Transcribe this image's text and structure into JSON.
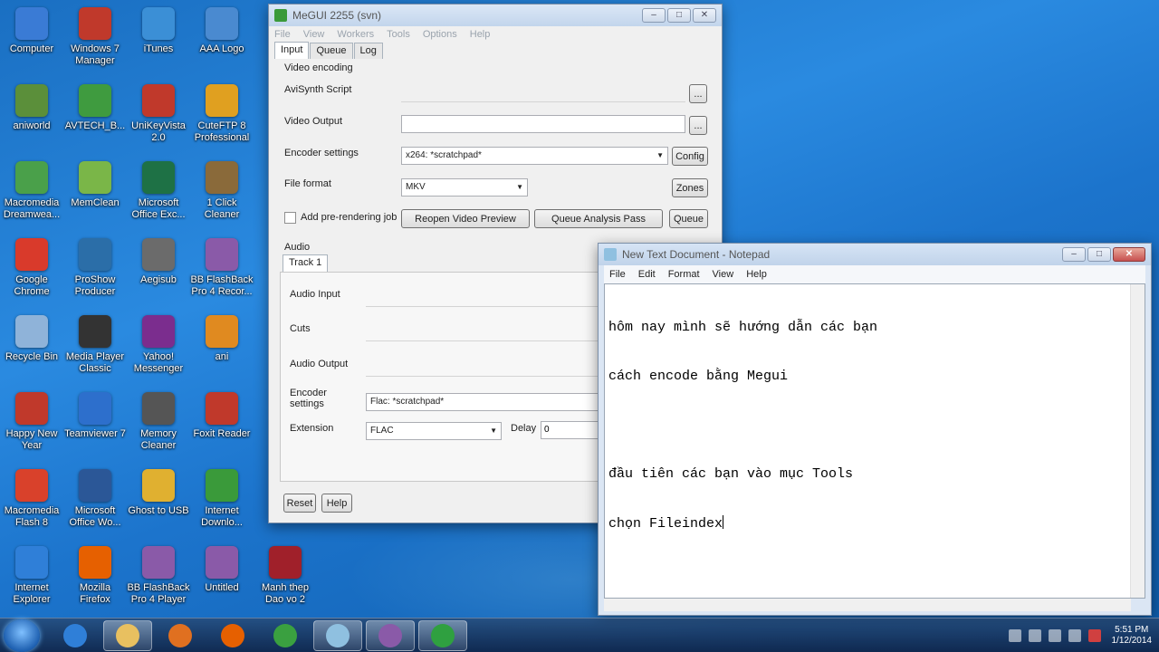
{
  "desktop": {
    "icons": [
      {
        "label": "Computer",
        "color": "#3a7bd5"
      },
      {
        "label": "aniworld",
        "color": "#5b8f3a"
      },
      {
        "label": "Macromedia Dreamwea...",
        "color": "#4aa04a"
      },
      {
        "label": "Google Chrome",
        "color": "#d93a2b"
      },
      {
        "label": "Recycle Bin",
        "color": "#8fb3d9"
      },
      {
        "label": "Happy New Year",
        "color": "#c0392b"
      },
      {
        "label": "Macromedia Flash 8",
        "color": "#d9412b"
      },
      {
        "label": "Internet Explorer",
        "color": "#2f7fd8"
      },
      {
        "label": "Windows 7 Manager",
        "color": "#c0392b"
      },
      {
        "label": "AVTECH_B...",
        "color": "#3f9b3f"
      },
      {
        "label": "MemClean",
        "color": "#7ab648"
      },
      {
        "label": "ProShow Producer",
        "color": "#2b6ea8"
      },
      {
        "label": "Media Player Classic",
        "color": "#333333"
      },
      {
        "label": "Teamviewer 7",
        "color": "#2d6fcc"
      },
      {
        "label": "Microsoft Office Wo...",
        "color": "#2b5797"
      },
      {
        "label": "Mozilla Firefox",
        "color": "#e66000"
      },
      {
        "label": "iTunes",
        "color": "#3b8fd6"
      },
      {
        "label": "UniKeyVista 2.0",
        "color": "#c0392b"
      },
      {
        "label": "Microsoft Office Exc...",
        "color": "#1e7145"
      },
      {
        "label": "Aegisub",
        "color": "#6b6b6b"
      },
      {
        "label": "Yahoo! Messenger",
        "color": "#7b2d8e"
      },
      {
        "label": "Memory Cleaner",
        "color": "#555555"
      },
      {
        "label": "Ghost to USB",
        "color": "#e0b030"
      },
      {
        "label": "BB FlashBack Pro 4 Player",
        "color": "#8a5aa8"
      },
      {
        "label": "AAA Logo",
        "color": "#4a8ad0"
      },
      {
        "label": "CuteFTP 8 Professional",
        "color": "#e0a020"
      },
      {
        "label": "1 Click Cleaner",
        "color": "#8a6a3a"
      },
      {
        "label": "BB FlashBack Pro 4 Recor...",
        "color": "#8a5aa8"
      },
      {
        "label": "ani",
        "color": "#e08a20"
      },
      {
        "label": "Foxit Reader",
        "color": "#c0392b"
      },
      {
        "label": "Internet Downlo...",
        "color": "#3a9a3a"
      },
      {
        "label": "Untitled",
        "color": "#8a5aa8"
      },
      {
        "label": "Manh thep Dao vo 2",
        "color": "#a0202a"
      }
    ]
  },
  "megui": {
    "title": "MeGUI 2255 (svn)",
    "menu": [
      "File",
      "View",
      "Workers",
      "Tools",
      "Options",
      "Help"
    ],
    "tabs": [
      "Input",
      "Queue",
      "Log"
    ],
    "video": {
      "group_title": "Video encoding",
      "avisynth_label": "AviSynth Script",
      "avisynth_value": "",
      "output_label": "Video Output",
      "output_value": "",
      "browse_label": "...",
      "encoder_label": "Encoder settings",
      "encoder_value": "x264: *scratchpad*",
      "config_label": "Config",
      "format_label": "File format",
      "format_value": "MKV",
      "zones_label": "Zones",
      "prerender_label": "Add pre-rendering job",
      "reopen_label": "Reopen Video Preview",
      "queue_analysis_label": "Queue Analysis Pass",
      "queue_label": "Queue"
    },
    "audio": {
      "group_title": "Audio",
      "track_tab": "Track 1",
      "input_label": "Audio Input",
      "cuts_label": "Cuts",
      "output_label": "Audio Output",
      "encoder_label": "Encoder settings",
      "encoder_value": "Flac: *scratchpad*",
      "extension_label": "Extension",
      "extension_value": "FLAC",
      "delay_label": "Delay",
      "delay_value": "0"
    },
    "footer": {
      "reset_label": "Reset",
      "help_label": "Help"
    }
  },
  "notepad": {
    "title": "New Text Document - Notepad",
    "menu": [
      "File",
      "Edit",
      "Format",
      "View",
      "Help"
    ],
    "lines": [
      "hôm nay mình sẽ hướng dẫn các bạn",
      "cách encode bằng Megui",
      "",
      "đầu tiên các bạn vào mục Tools",
      "chọn Fileindex"
    ]
  },
  "taskbar": {
    "clock_time": "5:51 PM",
    "clock_date": "1/12/2014",
    "items": [
      {
        "icon": "internet-explorer-icon",
        "color": "#2f7fd8"
      },
      {
        "icon": "file-explorer-icon",
        "color": "#e8c060"
      },
      {
        "icon": "media-player-icon",
        "color": "#e07020"
      },
      {
        "icon": "firefox-icon",
        "color": "#e66000"
      },
      {
        "icon": "chrome-icon",
        "color": "#3aa040"
      },
      {
        "icon": "notepad-icon",
        "color": "#8fc0e0"
      },
      {
        "icon": "bb-flashback-icon",
        "color": "#8a5aa8"
      },
      {
        "icon": "megui-icon",
        "color": "#2fa040"
      }
    ]
  }
}
